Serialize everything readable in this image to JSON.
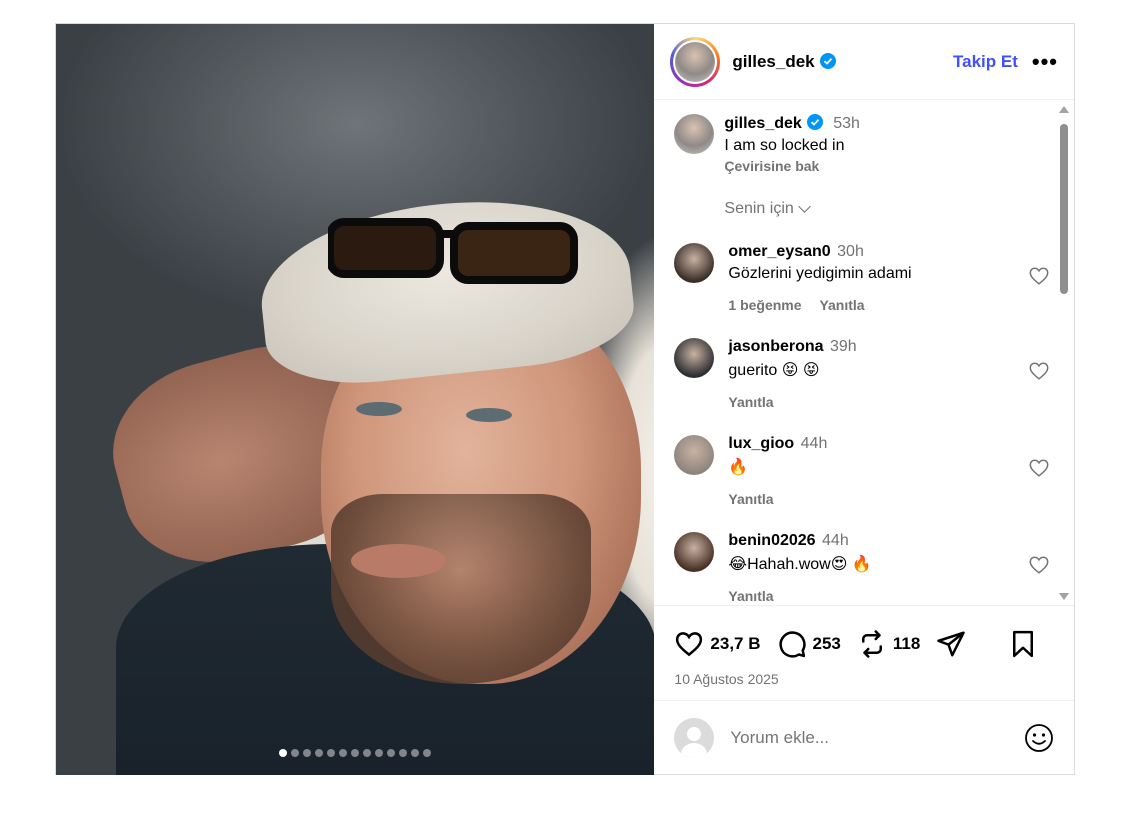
{
  "post": {
    "username": "gilles_dek",
    "follow_label": "Takip Et",
    "more_label": "•••",
    "next_label": "›",
    "slide_count": 13,
    "active_slide": 1
  },
  "caption": {
    "username": "gilles_dek",
    "time": "53h",
    "text": "I am so locked in",
    "translate_label": "Çevirisine bak"
  },
  "sort_label": "Senin için",
  "comments": [
    {
      "username": "omer_eysan0",
      "time": "30h",
      "text": "Gözlerini yedigimin adami",
      "likes": "1 beğenme",
      "reply": "Yanıtla",
      "avatar_color": "#3a2f28"
    },
    {
      "username": "jasonberona",
      "time": "39h",
      "text": "guerito 😝 😝",
      "likes": "",
      "reply": "Yanıtla",
      "avatar_color": "#2e2f33"
    },
    {
      "username": "lux_gioo",
      "time": "44h",
      "text": "🔥",
      "likes": "",
      "reply": "Yanıtla",
      "avatar_color": "#8d857d"
    },
    {
      "username": "benin02026",
      "time": "44h",
      "text": "😂Hahah.wow😍 🔥",
      "likes": "",
      "reply": "Yanıtla",
      "avatar_color": "#4a3127"
    }
  ],
  "actions": {
    "likes": "23,7 B",
    "comments": "253",
    "reposts": "118"
  },
  "date": "10 Ağustos 2025",
  "add_comment": {
    "placeholder": "Yorum ekle..."
  },
  "colors": {
    "accent": "#4150f7",
    "verified": "#0095f6",
    "muted": "#737373"
  }
}
